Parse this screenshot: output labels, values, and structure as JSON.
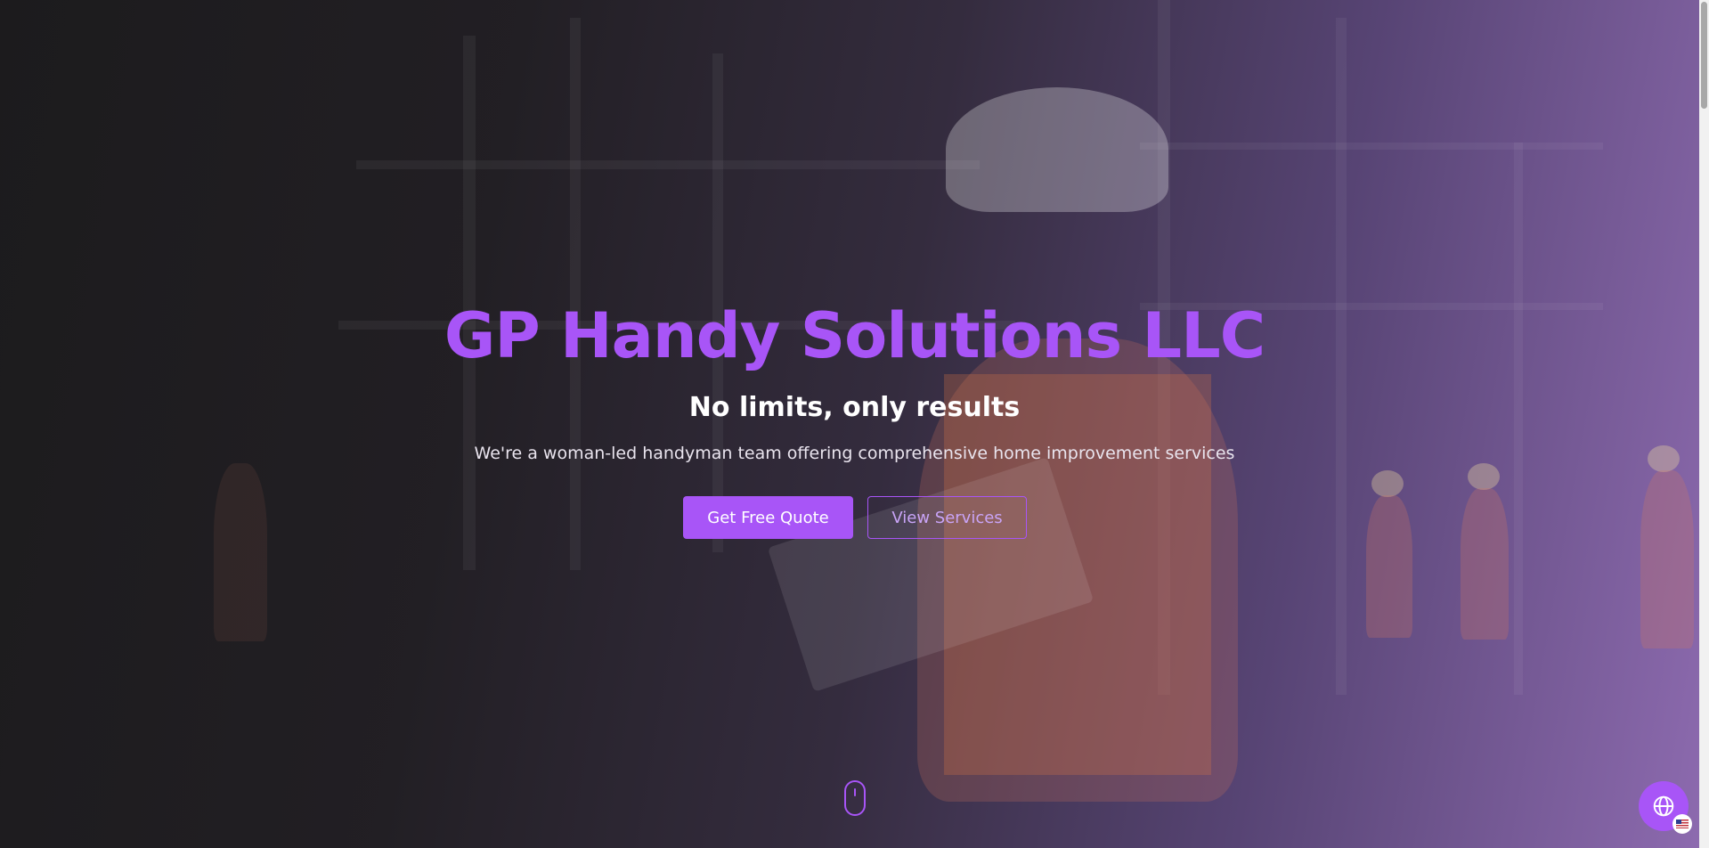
{
  "hero": {
    "title": "GP Handy Solutions LLC",
    "subtitle": "No limits, only results",
    "tagline": "We're a woman-led handyman team offering comprehensive home improvement services",
    "primary_button": "Get Free Quote",
    "secondary_button": "View Services"
  },
  "colors": {
    "accent": "#a855f7",
    "background": "#1c1b1d",
    "text": "#ffffff"
  },
  "icons": {
    "scroll": "mouse-scroll-icon",
    "language": "globe-icon",
    "flag": "us-flag-icon"
  }
}
